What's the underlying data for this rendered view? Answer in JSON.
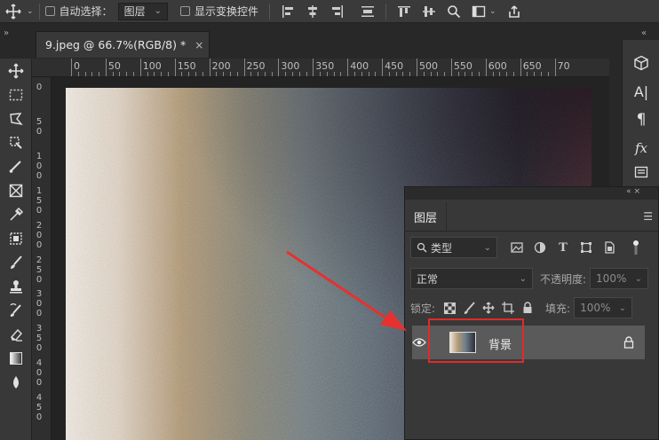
{
  "options_bar": {
    "auto_select_label": "自动选择：",
    "auto_select_target": "图层",
    "show_transform_label": "显示变换控件"
  },
  "document": {
    "tab_title": "9.jpeg @ 66.7%(RGB/8) *",
    "close_glyph": "×"
  },
  "ruler": {
    "h_labels": [
      "0",
      "50",
      "100",
      "150",
      "200",
      "250",
      "300",
      "350",
      "400",
      "450",
      "500",
      "550",
      "600",
      "650",
      "70"
    ],
    "v_labels": [
      "0",
      "5 0",
      "1 0 0",
      "1 5 0",
      "2 0 0",
      "2 5 0",
      "3 0 0",
      "3 5 0",
      "4 0 0",
      "4 5 0"
    ]
  },
  "toolbar": {
    "tools": [
      "move-tool-icon",
      "marquee-tool-icon",
      "lasso-tool-icon",
      "quick-select-tool-icon",
      "crop-tool-icon",
      "frame-tool-icon",
      "eyedropper-tool-icon",
      "healing-tool-icon",
      "brush-tool-icon",
      "stamp-tool-icon",
      "history-brush-icon",
      "eraser-tool-icon",
      "gradient-tool-icon",
      "blur-tool-icon"
    ]
  },
  "right_strip": {
    "icons": [
      "3d-icon",
      "character-icon",
      "paragraph-icon",
      "fx-icon",
      "properties-icon"
    ],
    "char_label": "A|",
    "para_label": "¶",
    "fx_label": "fx"
  },
  "layers_panel": {
    "tab_label": "图层",
    "filter_kind": "类型",
    "blend_mode": "正常",
    "opacity_label": "不透明度:",
    "opacity_value": "100%",
    "lock_label": "锁定:",
    "fill_label": "填充:",
    "fill_value": "100%",
    "layer_name": "背景"
  },
  "colors": {
    "highlight": "#e22a2a",
    "arrow": "#e5322f"
  }
}
